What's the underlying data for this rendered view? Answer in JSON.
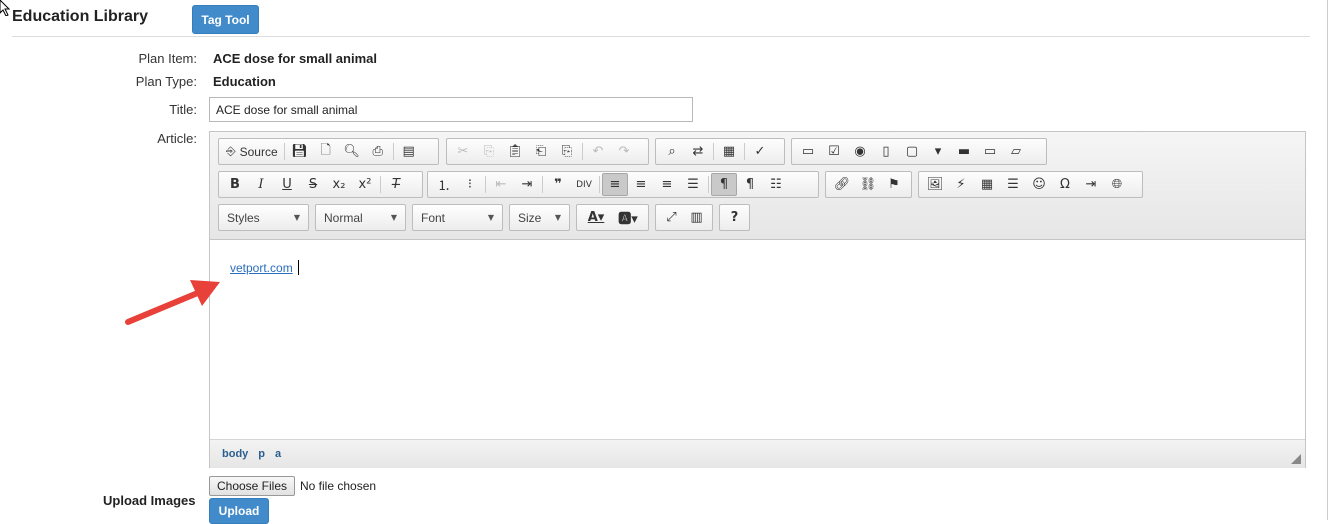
{
  "header": {
    "title": "Education Library",
    "tag_tool": "Tag Tool"
  },
  "fields": {
    "plan_item_label": "Plan Item:",
    "plan_item_value": "ACE dose for small animal",
    "plan_type_label": "Plan Type:",
    "plan_type_value": "Education",
    "title_label": "Title:",
    "title_value": "ACE dose for small animal",
    "article_label": "Article:"
  },
  "editor": {
    "source_label": "Source",
    "styles": "Styles",
    "format": "Normal",
    "font": "Font",
    "size": "Size",
    "content_link": "vetport.com",
    "path": [
      "body",
      "p",
      "a"
    ]
  },
  "upload": {
    "label": "Upload Images",
    "choose_files": "Choose Files",
    "no_file": "No file chosen",
    "upload_button": "Upload"
  },
  "colors": {
    "accent": "#428bca",
    "link": "#2a6ebb",
    "annotation_arrow": "#e8413a"
  }
}
